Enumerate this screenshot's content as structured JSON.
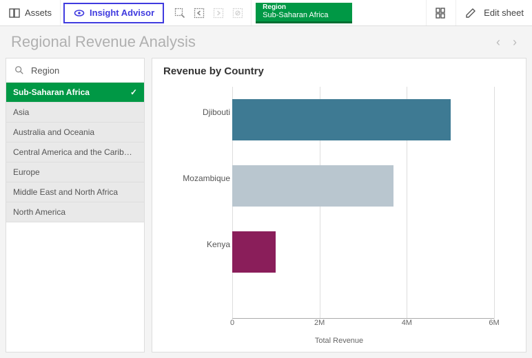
{
  "toolbar": {
    "assets_label": "Assets",
    "insight_label": "Insight Advisor",
    "tag_key": "Region",
    "tag_value": "Sub-Saharan Africa",
    "edit_label": "Edit sheet"
  },
  "sheet": {
    "title": "Regional Revenue Analysis"
  },
  "filter": {
    "field": "Region",
    "items": [
      {
        "label": "Sub-Saharan Africa",
        "selected": true
      },
      {
        "label": "Asia",
        "selected": false
      },
      {
        "label": "Australia and Oceania",
        "selected": false
      },
      {
        "label": "Central America and the Carib…",
        "selected": false
      },
      {
        "label": "Europe",
        "selected": false
      },
      {
        "label": "Middle East and North Africa",
        "selected": false
      },
      {
        "label": "North America",
        "selected": false
      }
    ]
  },
  "chart": {
    "title": "Revenue by Country"
  },
  "chart_data": {
    "type": "bar",
    "orientation": "horizontal",
    "title": "Revenue by Country",
    "xlabel": "Total Revenue",
    "ylabel": "",
    "xlim": [
      0,
      6000000
    ],
    "xticks": [
      0,
      2000000,
      4000000,
      6000000
    ],
    "xtick_labels": [
      "0",
      "2M",
      "4M",
      "6M"
    ],
    "categories": [
      "Djibouti",
      "Mozambique",
      "Kenya"
    ],
    "values": [
      5000000,
      3700000,
      1000000
    ],
    "colors": [
      "#3e7a93",
      "#b9c6cf",
      "#8a1e5a"
    ]
  }
}
